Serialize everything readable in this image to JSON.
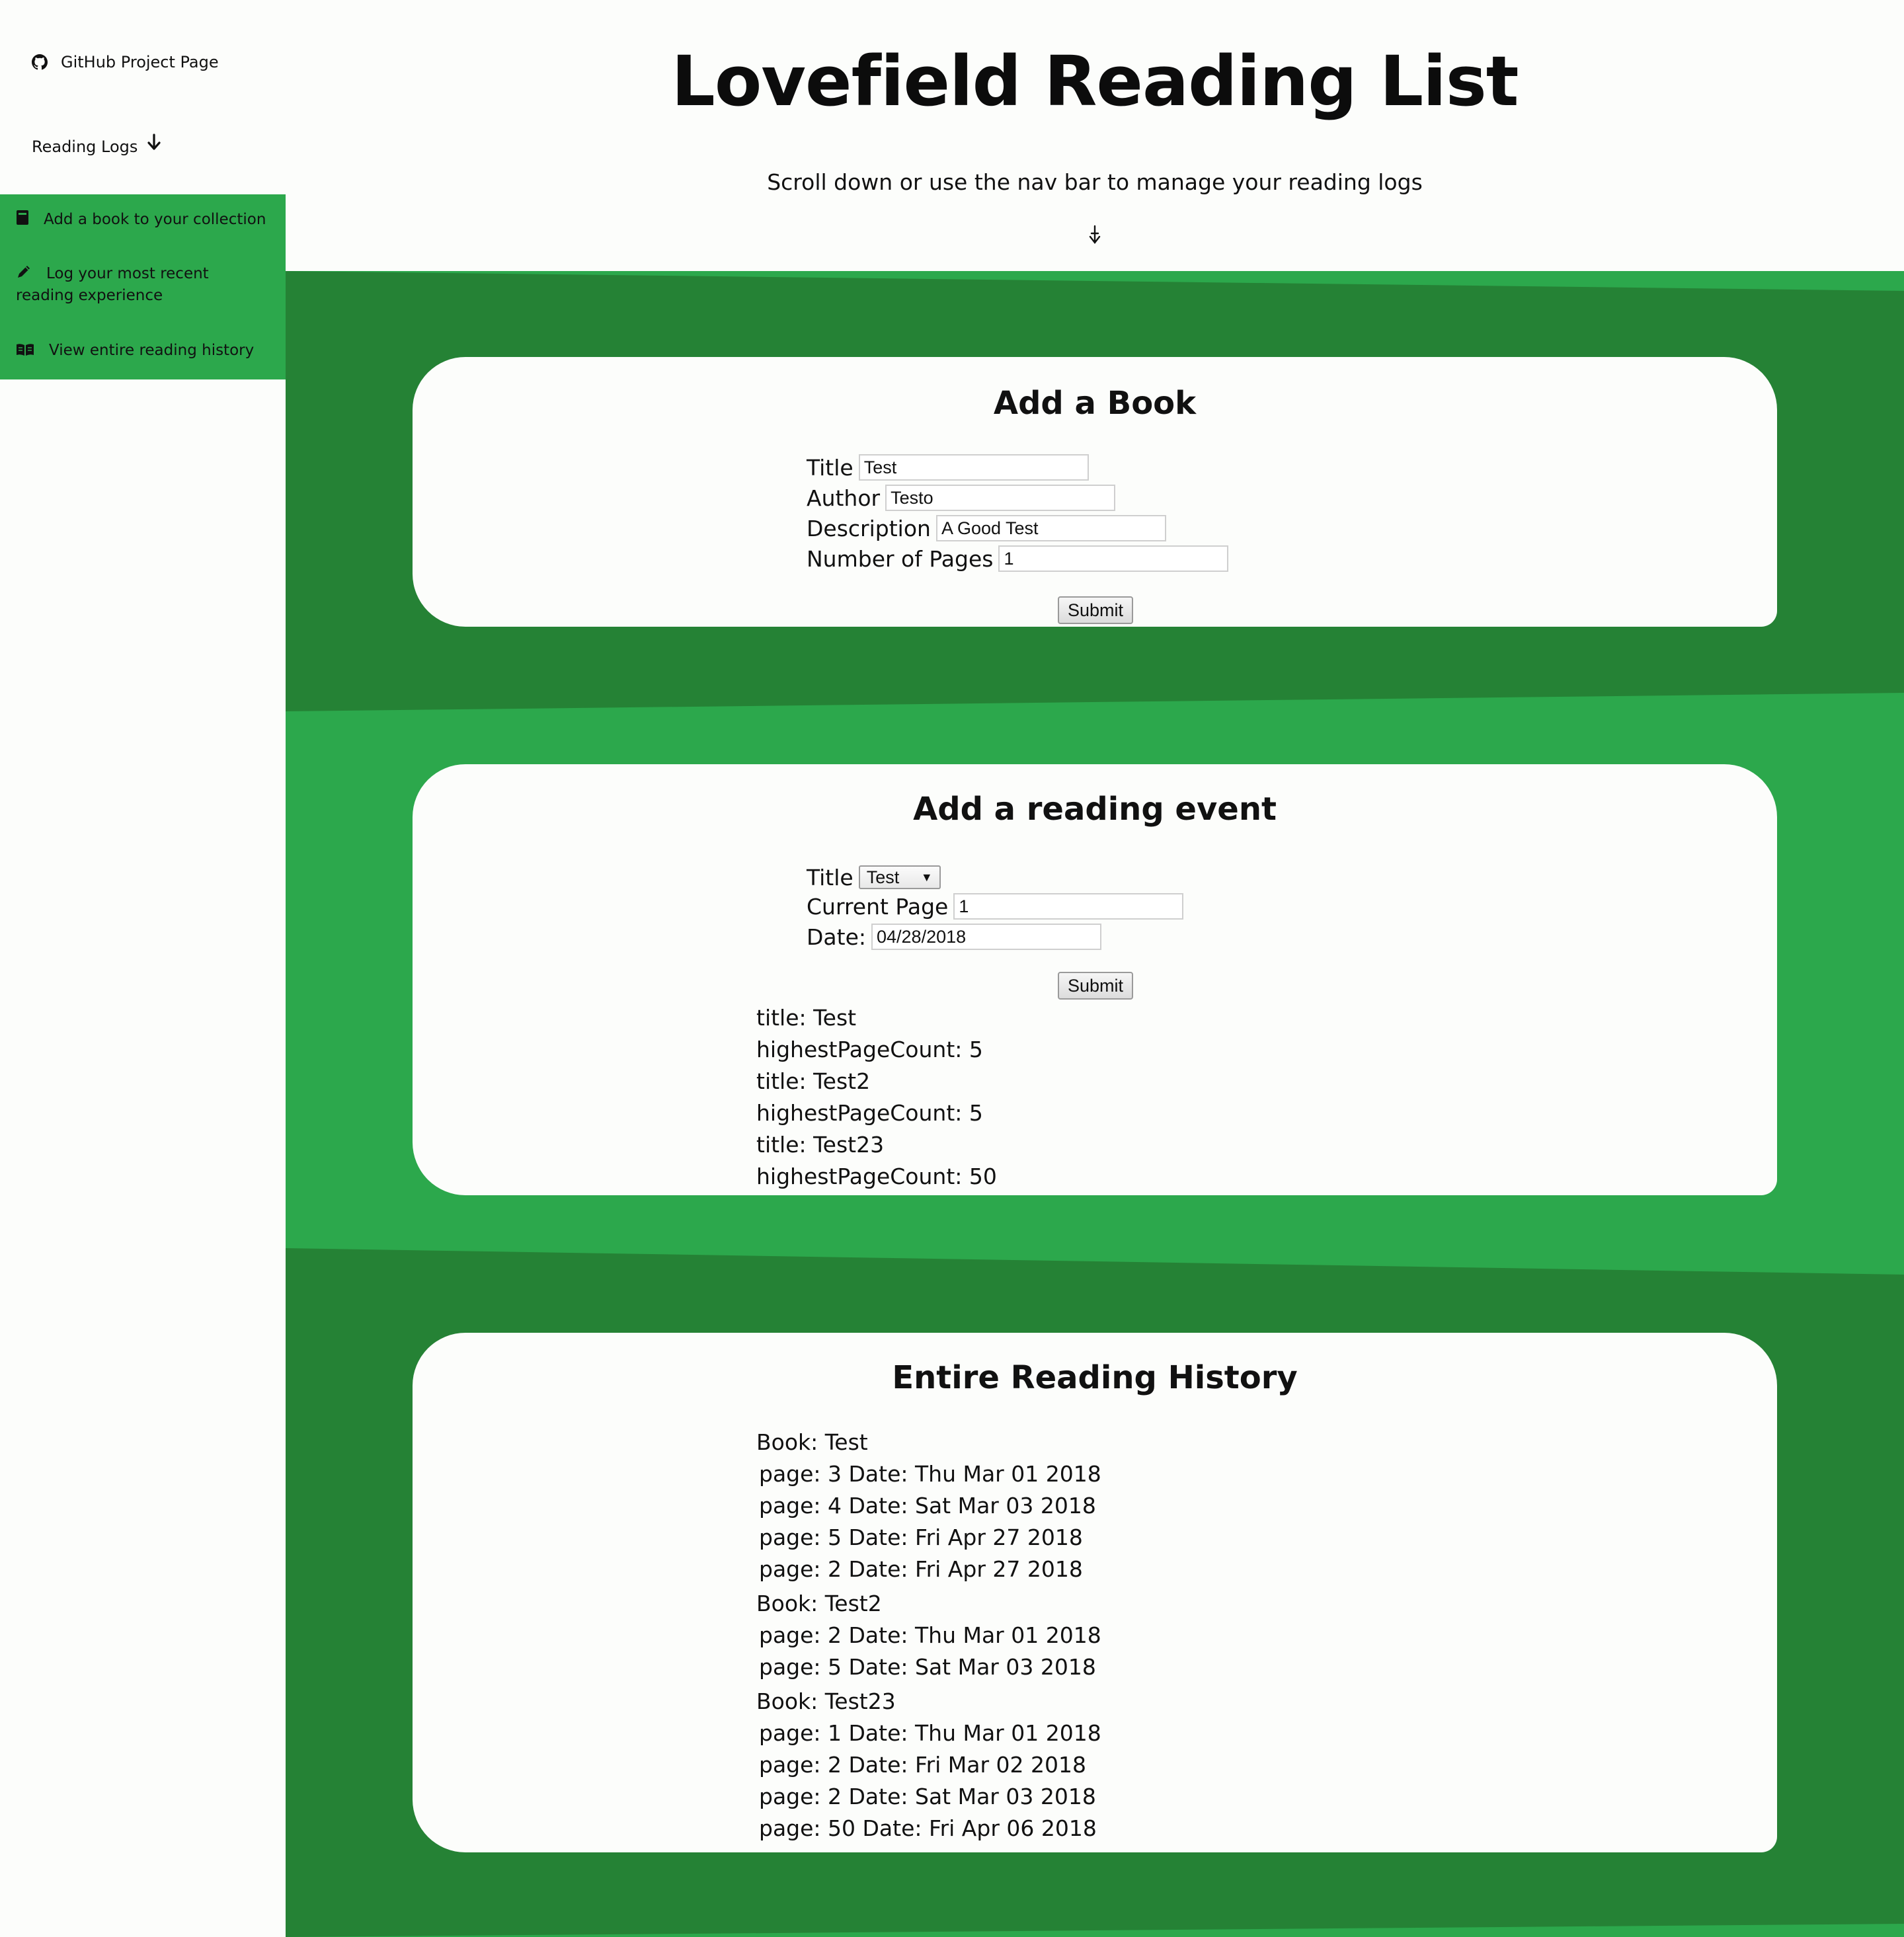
{
  "sidebar": {
    "github_label": "GitHub Project Page",
    "reading_logs_label": "Reading Logs",
    "menu": [
      {
        "label": "Add a book to your collection",
        "icon": "book-icon"
      },
      {
        "label": "Log your most recent reading experience",
        "icon": "pencil-icon"
      },
      {
        "label": "View entire reading history",
        "icon": "open-book-icon"
      }
    ]
  },
  "header": {
    "title": "Lovefield Reading List",
    "subtitle": "Scroll down or use the nav bar to manage your reading logs"
  },
  "colors": {
    "green_light": "#2ca84c",
    "green_dark": "#258235",
    "card": "#fcfdfb"
  },
  "add_book": {
    "heading": "Add a Book",
    "fields": [
      {
        "label": "Title",
        "value": "Test"
      },
      {
        "label": "Author",
        "value": "Testo"
      },
      {
        "label": "Description",
        "value": "A Good Test"
      },
      {
        "label": "Number of Pages",
        "value": "1"
      }
    ],
    "submit_label": "Submit"
  },
  "reading_event": {
    "heading": "Add a reading event",
    "title_label": "Title",
    "title_selected": "Test",
    "current_page_label": "Current Page",
    "current_page_value": "1",
    "date_label": "Date:",
    "date_value": "04/28/2018",
    "submit_label": "Submit",
    "summary": [
      "title: Test",
      "highestPageCount: 5",
      "title: Test2",
      "highestPageCount: 5",
      "title: Test23",
      "highestPageCount: 50"
    ]
  },
  "history": {
    "heading": "Entire Reading History",
    "books": [
      {
        "book": "Book: Test",
        "entries": [
          "page: 3 Date: Thu Mar 01 2018",
          "page: 4 Date: Sat Mar 03 2018",
          "page: 5 Date: Fri Apr 27 2018",
          "page: 2 Date: Fri Apr 27 2018"
        ]
      },
      {
        "book": "Book: Test2",
        "entries": [
          "page: 2 Date: Thu Mar 01 2018",
          "page: 5 Date: Sat Mar 03 2018"
        ]
      },
      {
        "book": "Book: Test23",
        "entries": [
          "page: 1 Date: Thu Mar 01 2018",
          "page: 2 Date: Fri Mar 02 2018",
          "page: 2 Date: Sat Mar 03 2018",
          "page: 50 Date: Fri Apr 06 2018"
        ]
      }
    ]
  }
}
